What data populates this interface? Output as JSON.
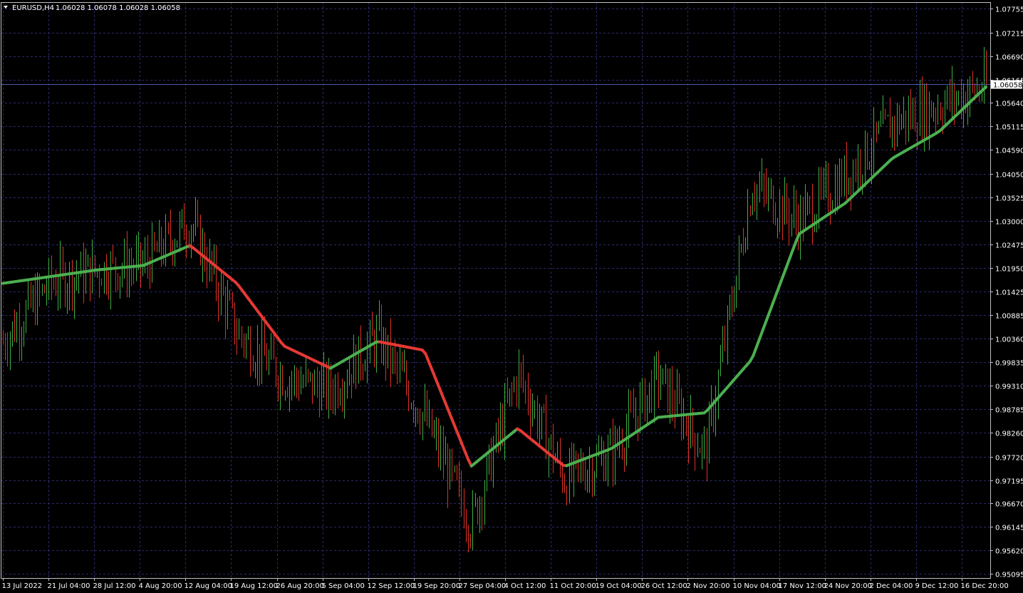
{
  "header": {
    "symbol": "EURUSD,H4",
    "ohlc": "1.06028 1.06078 1.06028 1.06058"
  },
  "current_price_label": "1.06058",
  "colors": {
    "background": "#000000",
    "grid": "#2a2a6e",
    "frame": "#c0c0c0",
    "bull": "#3cb043",
    "bear": "#e03024",
    "ma_up": "#4caf50",
    "ma_down": "#e53935",
    "price_line": "#4a5aa8",
    "text": "#ffffff"
  },
  "chart_data": {
    "type": "candlestick",
    "timeframe": "H4",
    "ylim": [
      0.9508,
      1.07755
    ],
    "y_ticks": [
      "1.07755",
      "1.07215",
      "1.06690",
      "1.06165",
      "1.05640",
      "1.05115",
      "1.04590",
      "1.04050",
      "1.03525",
      "1.03000",
      "1.02475",
      "1.01950",
      "1.01425",
      "1.00885",
      "1.00360",
      "0.99835",
      "0.99310",
      "0.98785",
      "0.98260",
      "0.97720",
      "0.97195",
      "0.96670",
      "0.96145",
      "0.95620",
      "0.95095"
    ],
    "x_ticks": [
      "13 Jul 2022",
      "21 Jul 04:00",
      "28 Jul 12:00",
      "4 Aug 20:00",
      "12 Aug 04:00",
      "19 Aug 12:00",
      "26 Aug 20:00",
      "5 Sep 04:00",
      "12 Sep 12:00",
      "19 Sep 20:00",
      "27 Sep 04:00",
      "4 Oct 12:00",
      "11 Oct 20:00",
      "19 Oct 04:00",
      "26 Oct 12:00",
      "2 Nov 20:00",
      "10 Nov 04:00",
      "17 Nov 12:00",
      "24 Nov 20:00",
      "2 Dec 04:00",
      "9 Dec 12:00",
      "16 Dec 20:00"
    ],
    "close_series": {
      "x": [
        "13 Jul 2022",
        "21 Jul 04:00",
        "28 Jul 12:00",
        "4 Aug 20:00",
        "12 Aug 04:00",
        "19 Aug 12:00",
        "26 Aug 20:00",
        "5 Sep 04:00",
        "12 Sep 12:00",
        "19 Sep 20:00",
        "27 Sep 04:00",
        "4 Oct 12:00",
        "11 Oct 20:00",
        "19 Oct 04:00",
        "26 Oct 12:00",
        "2 Nov 20:00",
        "10 Nov 04:00",
        "17 Nov 12:00",
        "24 Nov 20:00",
        "2 Dec 04:00",
        "9 Dec 12:00",
        "16 Dec 20:00"
      ],
      "y": [
        1.003,
        1.016,
        1.019,
        1.02,
        1.03,
        1.005,
        0.995,
        0.992,
        1.004,
        0.986,
        0.962,
        0.996,
        0.972,
        0.978,
        0.995,
        0.978,
        1.038,
        1.03,
        1.04,
        1.052,
        1.056,
        1.06
      ]
    },
    "moving_average": {
      "x": [
        "13 Jul 2022",
        "21 Jul 04:00",
        "28 Jul 12:00",
        "4 Aug 20:00",
        "12 Aug 04:00",
        "19 Aug 12:00",
        "26 Aug 20:00",
        "5 Sep 04:00",
        "12 Sep 12:00",
        "19 Sep 20:00",
        "27 Sep 04:00",
        "4 Oct 12:00",
        "11 Oct 20:00",
        "19 Oct 04:00",
        "26 Oct 12:00",
        "2 Nov 20:00",
        "10 Nov 04:00",
        "17 Nov 12:00",
        "24 Nov 20:00",
        "2 Dec 04:00",
        "9 Dec 12:00",
        "16 Dec 20:00"
      ],
      "y": [
        1.016,
        1.0175,
        1.019,
        1.02,
        1.0245,
        1.016,
        1.002,
        0.997,
        1.003,
        1.001,
        0.975,
        0.9835,
        0.975,
        0.979,
        0.986,
        0.987,
        0.999,
        1.027,
        1.034,
        1.044,
        1.05,
        1.06
      ]
    }
  }
}
